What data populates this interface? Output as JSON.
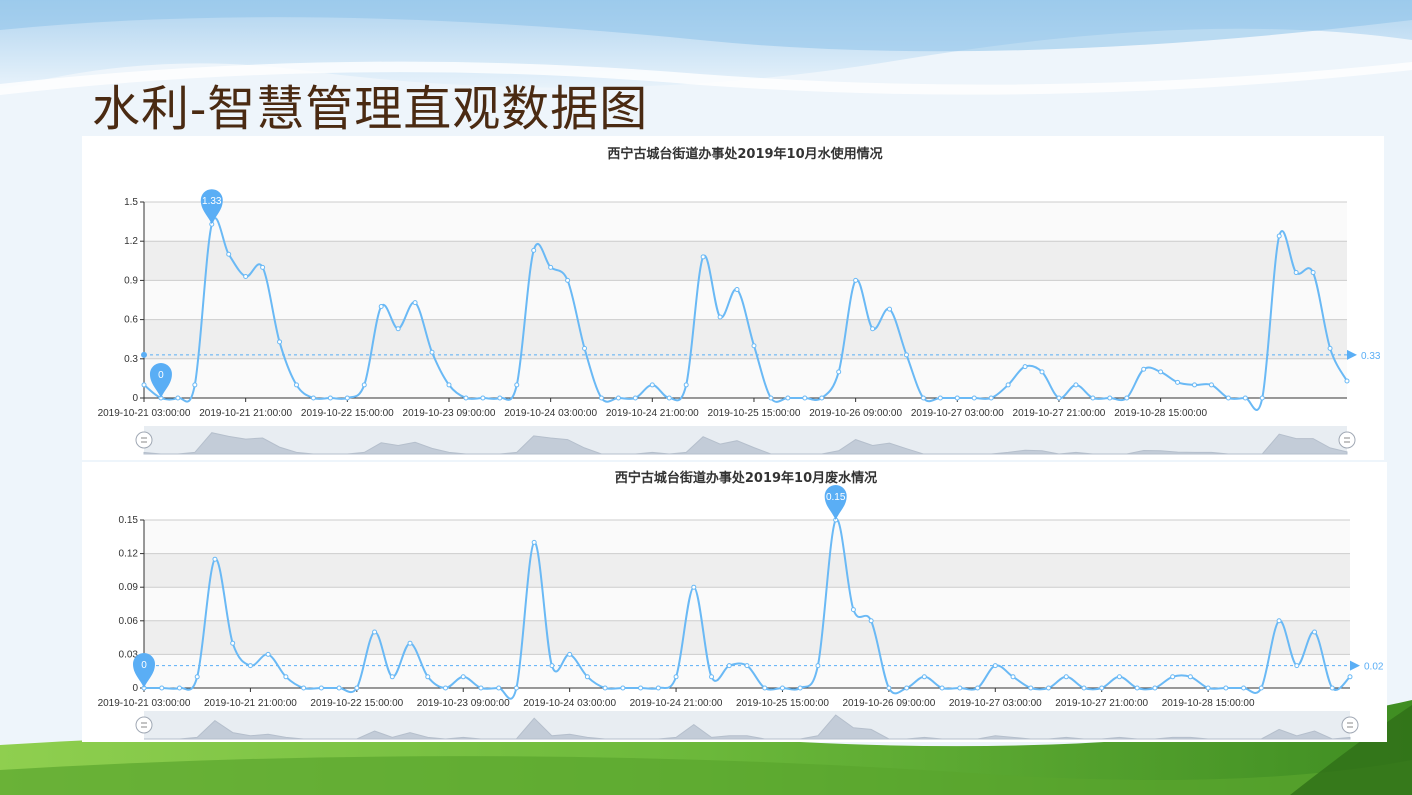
{
  "page": {
    "title": "水利-智慧管理直观数据图"
  },
  "colors": {
    "line": "#6ab9f5",
    "marker": "#5aaef5",
    "band": "#eeeeee",
    "grid": "#cccccc",
    "axis": "#333333",
    "slider": "#d6dee8",
    "title_text": "#4a2a12"
  },
  "chart_data": [
    {
      "type": "line",
      "title": "西宁古城台街道办事处2019年10月水使用情况",
      "x_labels": [
        "2019-10-21 03:00:00",
        "2019-10-21 21:00:00",
        "2019-10-22 15:00:00",
        "2019-10-23 09:00:00",
        "2019-10-24 03:00:00",
        "2019-10-24 21:00:00",
        "2019-10-25 15:00:00",
        "2019-10-26 09:00:00",
        "2019-10-27 03:00:00",
        "2019-10-27 21:00:00",
        "2019-10-28 15:00:00"
      ],
      "x_interval_hours": 3,
      "y_ticks": [
        "0",
        "0.3",
        "0.6",
        "0.9",
        "1.2",
        "1.5"
      ],
      "ylim": [
        0,
        1.5
      ],
      "grid": true,
      "smooth": true,
      "values": [
        0.1,
        0,
        0,
        0.1,
        1.33,
        1.1,
        0.93,
        1.0,
        0.43,
        0.1,
        0,
        0,
        0,
        0.1,
        0.7,
        0.53,
        0.73,
        0.35,
        0.1,
        0,
        0,
        0,
        0.1,
        1.13,
        1.0,
        0.9,
        0.38,
        0,
        0,
        0,
        0.1,
        0,
        0.1,
        1.08,
        0.62,
        0.83,
        0.4,
        0,
        0,
        0,
        0,
        0.2,
        0.9,
        0.53,
        0.68,
        0.33,
        0,
        0,
        0,
        0,
        0,
        0.1,
        0.24,
        0.2,
        0,
        0.1,
        0,
        0,
        0,
        0.22,
        0.2,
        0.12,
        0.1,
        0.1,
        0,
        0,
        0,
        1.24,
        0.96,
        0.96,
        0.38,
        0.13
      ],
      "mark_points": [
        {
          "label": "1.33",
          "index": 4,
          "value": 1.33
        },
        {
          "label": "0",
          "index": 1,
          "value": 0
        }
      ],
      "mark_line": {
        "label": "0.33",
        "value": 0.33
      },
      "datazoom": {
        "start_percent": 0,
        "end_percent": 100
      }
    },
    {
      "type": "line",
      "title": "西宁古城台街道办事处2019年10月废水情况",
      "x_labels": [
        "2019-10-21 03:00:00",
        "2019-10-21 21:00:00",
        "2019-10-22 15:00:00",
        "2019-10-23 09:00:00",
        "2019-10-24 03:00:00",
        "2019-10-24 21:00:00",
        "2019-10-25 15:00:00",
        "2019-10-26 09:00:00",
        "2019-10-27 03:00:00",
        "2019-10-27 21:00:00",
        "2019-10-28 15:00:00"
      ],
      "x_interval_hours": 3,
      "y_ticks": [
        "0",
        "0.03",
        "0.06",
        "0.09",
        "0.12",
        "0.15"
      ],
      "ylim": [
        0,
        0.15
      ],
      "grid": true,
      "smooth": true,
      "values": [
        0,
        0,
        0,
        0.01,
        0.115,
        0.04,
        0.02,
        0.03,
        0.01,
        0,
        0,
        0,
        0,
        0.05,
        0.01,
        0.04,
        0.01,
        0,
        0.01,
        0,
        0,
        0,
        0.13,
        0.02,
        0.03,
        0.01,
        0,
        0,
        0,
        0,
        0.01,
        0.09,
        0.01,
        0.02,
        0.02,
        0,
        0,
        0,
        0.02,
        0.15,
        0.07,
        0.06,
        0,
        0,
        0.01,
        0,
        0,
        0,
        0.02,
        0.01,
        0,
        0,
        0.01,
        0,
        0,
        0.01,
        0,
        0,
        0.01,
        0.01,
        0,
        0,
        0,
        0,
        0.06,
        0.02,
        0.05,
        0,
        0.01
      ],
      "mark_points": [
        {
          "label": "0.15",
          "index": 39,
          "value": 0.15
        },
        {
          "label": "0",
          "index": 0,
          "value": 0
        }
      ],
      "mark_line": {
        "label": "0.02",
        "value": 0.02
      },
      "datazoom": {
        "start_percent": 0,
        "end_percent": 100
      }
    }
  ]
}
